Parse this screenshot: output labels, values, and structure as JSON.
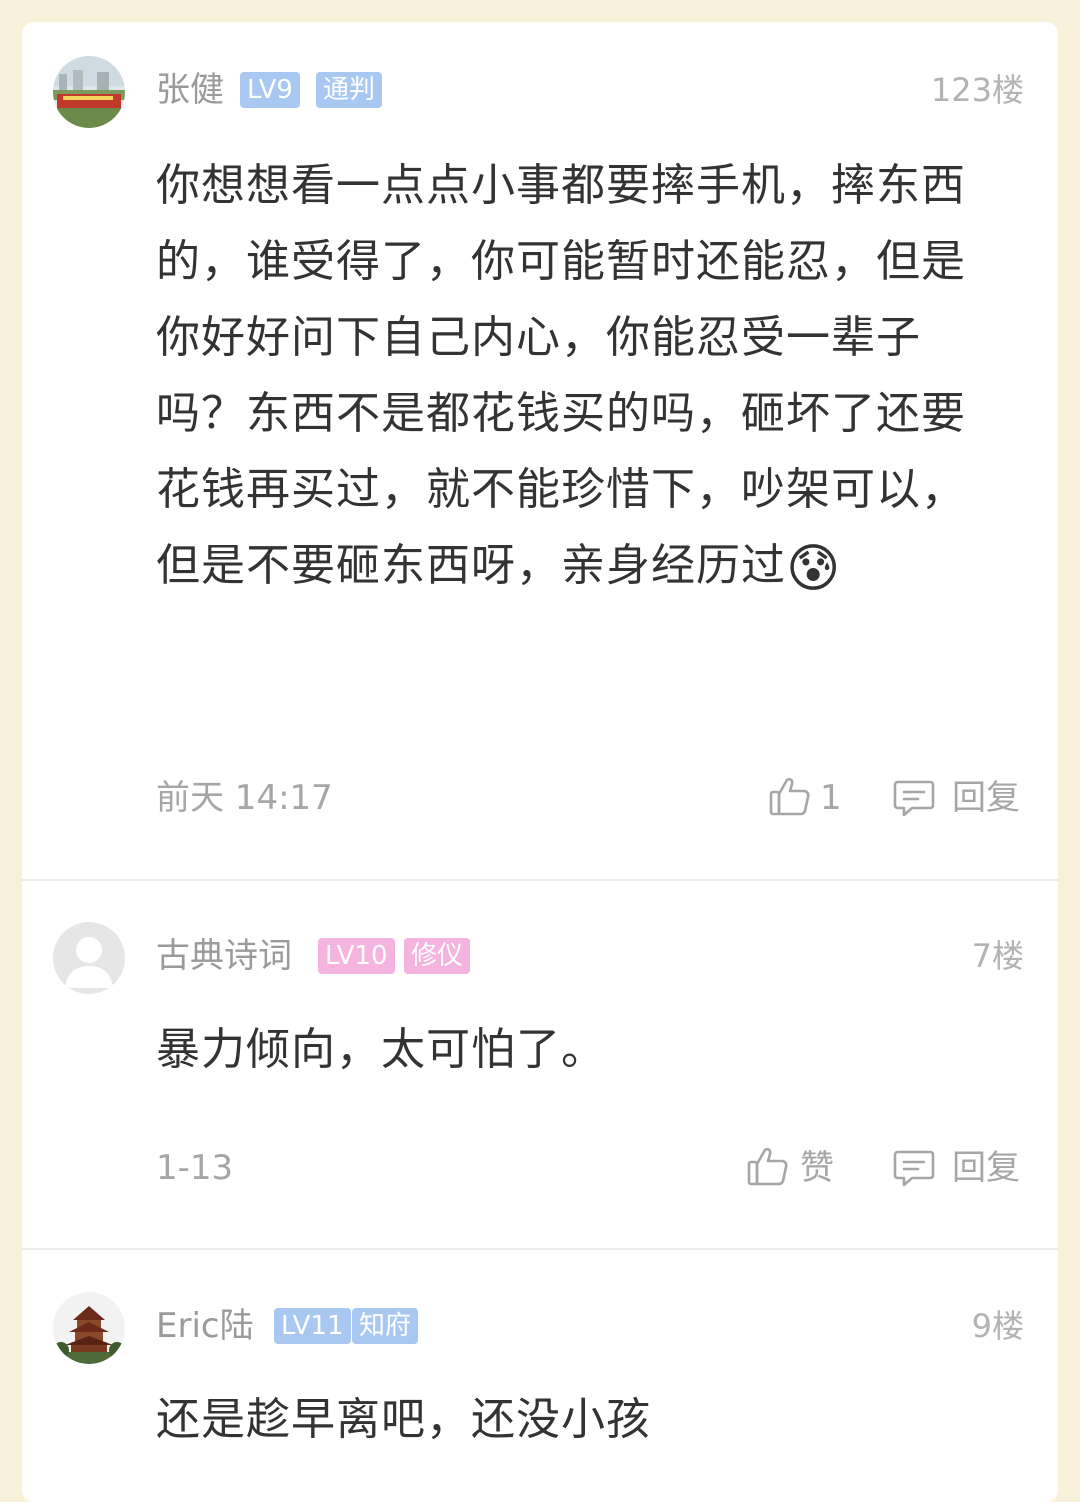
{
  "comments": [
    {
      "name": "张健",
      "level": "LV9",
      "title": "通判",
      "floor": "123楼",
      "text": "你想想看一点点小事都要摔手机，摔东西的，谁受得了，你可能暂时还能忍，但是你好好问下自己内心，你能忍受一辈子吗？东西不是都花钱买的吗，砸坏了还要花钱再买过，就不能珍惜下，吵架可以，但是不要砸东西呀，亲身经历过",
      "emoji": "😰",
      "time": "前天 14:17",
      "likes": "1",
      "reply": "回复"
    },
    {
      "name": "古典诗词",
      "level": "LV10",
      "title": "修仪",
      "floor": "7楼",
      "text": "暴力倾向，太可怕了。",
      "time": "1-13",
      "likes": "赞",
      "reply": "回复"
    },
    {
      "name": "Eric陆",
      "level": "LV11",
      "title": "知府",
      "floor": "9楼",
      "text": "还是趁早离吧，还没小孩"
    }
  ],
  "colors": {
    "badge_blue": "#a8c8f2",
    "badge_pink": "#f5b3e0",
    "background": "#f7f1da"
  },
  "icons": [
    "thumbs-up-icon",
    "comment-icon"
  ]
}
